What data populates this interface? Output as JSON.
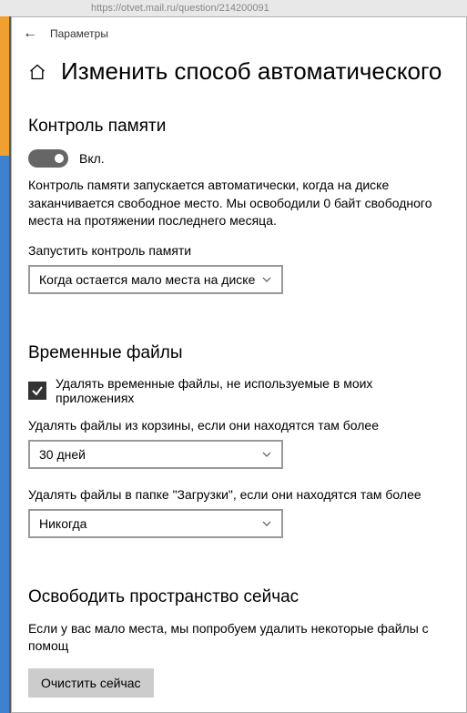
{
  "browser_url_fragment": "https://otvet.mail.ru/question/214200091",
  "window_title": "Параметры",
  "page_title": "Изменить способ автоматического",
  "section1": {
    "title": "Контроль памяти",
    "toggle_on": true,
    "toggle_label": "Вкл.",
    "description": "Контроль памяти запускается автоматически, когда на диске заканчивается свободное место. Мы освободили 0 байт свободного места на протяжении последнего месяца.",
    "run_label": "Запустить контроль памяти",
    "run_value": "Когда остается мало места на диске"
  },
  "section2": {
    "title": "Временные файлы",
    "checkbox_checked": true,
    "checkbox_label": "Удалять временные файлы, не используемые в моих приложениях",
    "recycle_label": "Удалять файлы из корзины, если они находятся там более",
    "recycle_value": "30 дней",
    "downloads_label": "Удалять файлы в папке \"Загрузки\", если они находятся там более",
    "downloads_value": "Никогда"
  },
  "section3": {
    "title": "Освободить пространство сейчас",
    "description": "Если у вас мало места, мы попробуем удалить некоторые файлы с помощ",
    "button_label": "Очистить сейчас"
  }
}
